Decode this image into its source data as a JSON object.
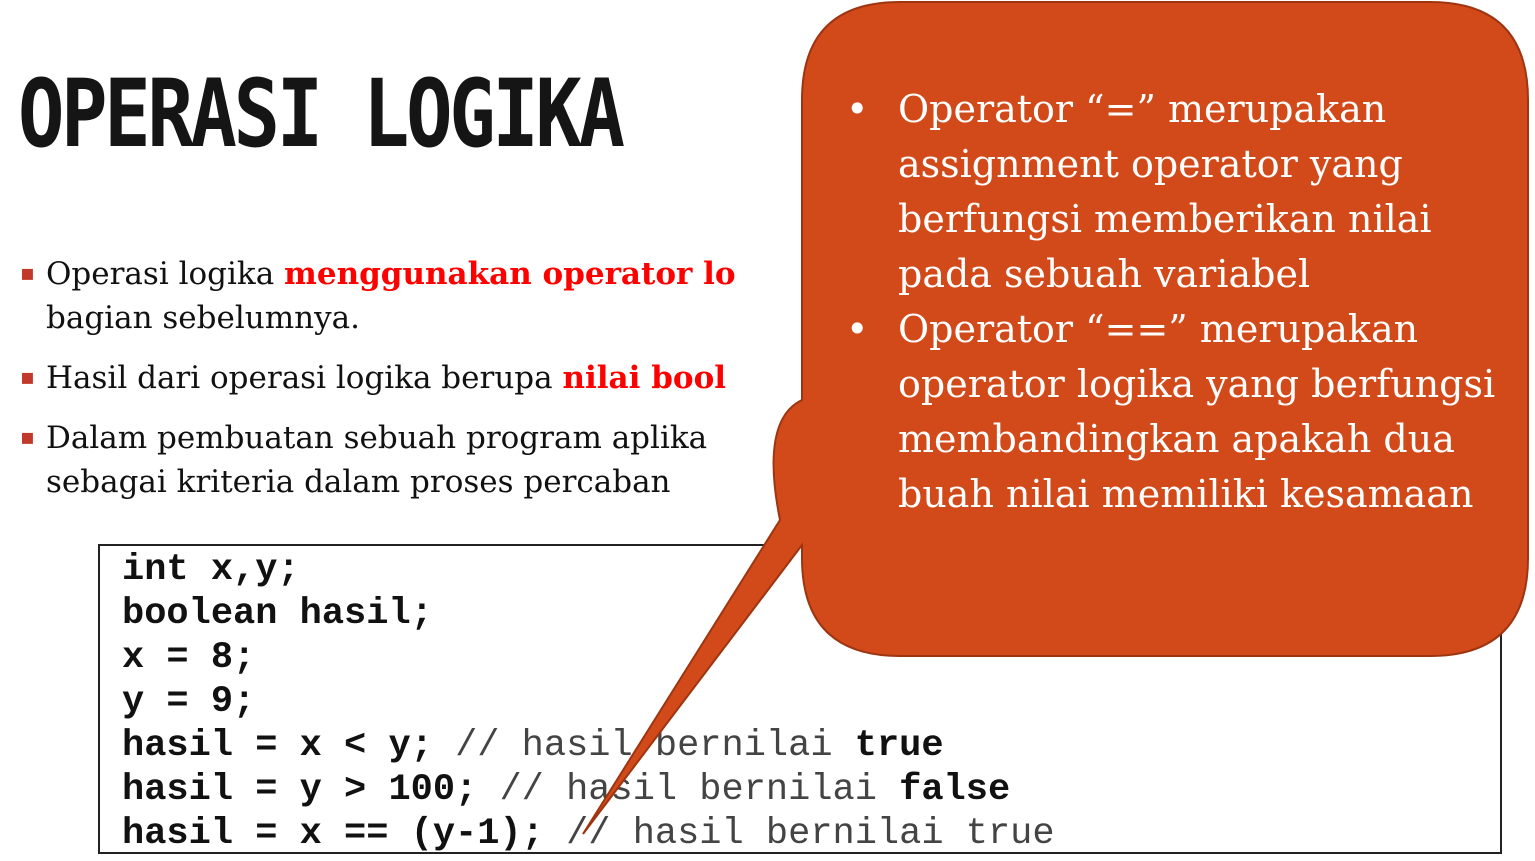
{
  "slide": {
    "title": "OPERASI LOGIKA",
    "bullets": [
      {
        "segments": [
          {
            "text": "Operasi logika ",
            "highlight": false
          },
          {
            "text": "menggunakan operator lo",
            "highlight": true
          }
        ],
        "line2": "bagian sebelumnya."
      },
      {
        "segments": [
          {
            "text": "Hasil dari operasi logika berupa ",
            "highlight": false
          },
          {
            "text": "nilai bool",
            "highlight": true
          }
        ],
        "line2": ""
      },
      {
        "segments": [
          {
            "text": "Dalam pembuatan sebuah program aplika",
            "highlight": false
          }
        ],
        "line2": "sebagai kriteria dalam proses percaban"
      }
    ],
    "code_lines": [
      [
        {
          "t": "int x,y;",
          "s": "b"
        }
      ],
      [
        {
          "t": "boolean hasil;",
          "s": "b"
        }
      ],
      [
        {
          "t": "x = 8;",
          "s": "b"
        }
      ],
      [
        {
          "t": "y = 9;",
          "s": "b"
        }
      ],
      [
        {
          "t": "hasil = x < y;",
          "s": "b"
        },
        {
          "t": " // hasil bernilai ",
          "s": "c"
        },
        {
          "t": "true",
          "s": "b"
        }
      ],
      [
        {
          "t": "hasil = y > 100;",
          "s": "b"
        },
        {
          "t": " // hasil bernilai ",
          "s": "c"
        },
        {
          "t": "false",
          "s": "b"
        }
      ],
      [
        {
          "t": "hasil = x == (y-1);",
          "s": "b"
        },
        {
          "t": " // hasil bernilai true",
          "s": "c"
        }
      ]
    ],
    "bullet_marker": "▪",
    "colors": {
      "highlight": "#ff0000",
      "callout_fill": "#d24a1a",
      "callout_border": "#9e3510",
      "bullet_marker": "#c0392b"
    }
  },
  "callout": {
    "marker": "•",
    "items": [
      "Operator “=” merupakan assignment operator yang berfungsi memberikan nilai pada sebuah variabel",
      "Operator “==” merupakan operator logika yang berfungsi membandingkan apakah dua buah nilai memiliki kesamaan"
    ]
  }
}
